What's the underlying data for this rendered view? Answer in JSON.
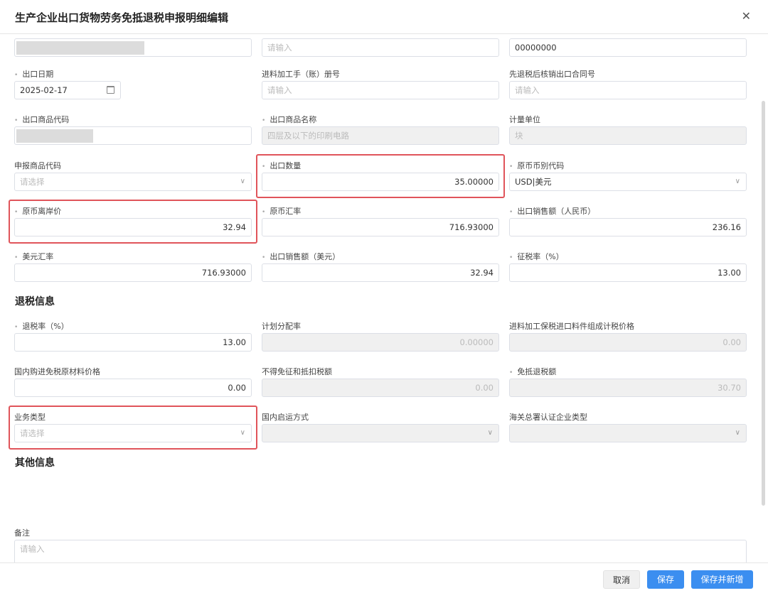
{
  "dialog": {
    "title": "生产企业出口货物劳务免抵退税申报明细编辑",
    "close_icon": "close-icon"
  },
  "fields": [
    {
      "label": "",
      "required": false,
      "value": "",
      "placeholder": "",
      "kind": "input",
      "disabled": false,
      "align": "left",
      "masked": true
    },
    {
      "label": "",
      "required": false,
      "value": "",
      "placeholder": "请输入",
      "kind": "input",
      "disabled": false,
      "align": "left"
    },
    {
      "label": "",
      "required": false,
      "value": "00000000",
      "placeholder": "",
      "kind": "input",
      "disabled": false,
      "align": "left"
    },
    {
      "label": "出口日期",
      "required": true,
      "value": "2025-02-17",
      "placeholder": "",
      "kind": "date",
      "disabled": false,
      "align": "left"
    },
    {
      "label": "进料加工手（账）册号",
      "required": false,
      "value": "",
      "placeholder": "请输入",
      "kind": "input",
      "disabled": false,
      "align": "left"
    },
    {
      "label": "先退税后核销出口合同号",
      "required": false,
      "value": "",
      "placeholder": "请输入",
      "kind": "input",
      "disabled": false,
      "align": "left"
    },
    {
      "label": "出口商品代码",
      "required": true,
      "value": "",
      "placeholder": "",
      "kind": "input",
      "disabled": false,
      "align": "left",
      "masked": true
    },
    {
      "label": "出口商品名称",
      "required": true,
      "value": "四层及以下的印刷电路",
      "placeholder": "",
      "kind": "input",
      "disabled": true,
      "align": "left"
    },
    {
      "label": "计量单位",
      "required": false,
      "value": "块",
      "placeholder": "",
      "kind": "input",
      "disabled": true,
      "align": "left"
    },
    {
      "label": "申报商品代码",
      "required": false,
      "value": "",
      "placeholder": "请选择",
      "kind": "select",
      "disabled": false,
      "align": "left"
    },
    {
      "label": "出口数量",
      "required": true,
      "value": "35.00000",
      "placeholder": "",
      "kind": "input",
      "disabled": false,
      "align": "right",
      "highlighted": true
    },
    {
      "label": "原币币别代码",
      "required": true,
      "value": "USD|美元",
      "placeholder": "",
      "kind": "select",
      "disabled": false,
      "align": "left"
    },
    {
      "label": "原币离岸价",
      "required": true,
      "value": "32.94",
      "placeholder": "",
      "kind": "input",
      "disabled": false,
      "align": "right",
      "highlighted": true
    },
    {
      "label": "原币汇率",
      "required": true,
      "value": "716.93000",
      "placeholder": "",
      "kind": "input",
      "disabled": false,
      "align": "right"
    },
    {
      "label": "出口销售额（人民币）",
      "required": true,
      "value": "236.16",
      "placeholder": "",
      "kind": "input",
      "disabled": false,
      "align": "right"
    },
    {
      "label": "美元汇率",
      "required": true,
      "value": "716.93000",
      "placeholder": "",
      "kind": "input",
      "disabled": false,
      "align": "right"
    },
    {
      "label": "出口销售额（美元）",
      "required": true,
      "value": "32.94",
      "placeholder": "",
      "kind": "input",
      "disabled": false,
      "align": "right"
    },
    {
      "label": "征税率（%）",
      "required": true,
      "value": "13.00",
      "placeholder": "",
      "kind": "input",
      "disabled": false,
      "align": "right"
    },
    {
      "label": "退税率（%）",
      "required": true,
      "value": "13.00",
      "placeholder": "",
      "kind": "input",
      "disabled": false,
      "align": "right"
    },
    {
      "label": "计划分配率",
      "required": false,
      "value": "0.00000",
      "placeholder": "",
      "kind": "input",
      "disabled": true,
      "align": "right"
    },
    {
      "label": "进料加工保税进口料件组成计税价格",
      "required": false,
      "value": "0.00",
      "placeholder": "",
      "kind": "input",
      "disabled": true,
      "align": "right"
    },
    {
      "label": "国内购进免税原材料价格",
      "required": false,
      "value": "0.00",
      "placeholder": "",
      "kind": "input",
      "disabled": false,
      "align": "right"
    },
    {
      "label": "不得免征和抵扣税额",
      "required": false,
      "value": "0.00",
      "placeholder": "",
      "kind": "input",
      "disabled": true,
      "align": "right"
    },
    {
      "label": "免抵退税额",
      "required": true,
      "value": "30.70",
      "placeholder": "",
      "kind": "input",
      "disabled": true,
      "align": "right"
    },
    {
      "label": "业务类型",
      "required": false,
      "value": "",
      "placeholder": "请选择",
      "kind": "select",
      "disabled": false,
      "align": "left",
      "highlighted": true
    },
    {
      "label": "国内启运方式",
      "required": false,
      "value": "",
      "placeholder": "",
      "kind": "select",
      "disabled": true,
      "align": "left"
    },
    {
      "label": "海关总署认证企业类型",
      "required": false,
      "value": "",
      "placeholder": "",
      "kind": "select",
      "disabled": true,
      "align": "left"
    }
  ],
  "sections": {
    "tax_refund": "退税信息",
    "other": "其他信息"
  },
  "remarks": {
    "label": "备注",
    "placeholder": "请输入"
  },
  "footer": {
    "cancel": "取消",
    "save": "保存",
    "save_and_new": "保存并新增"
  },
  "colors": {
    "primary": "#3b8ef0",
    "highlight": "#e0545a"
  }
}
